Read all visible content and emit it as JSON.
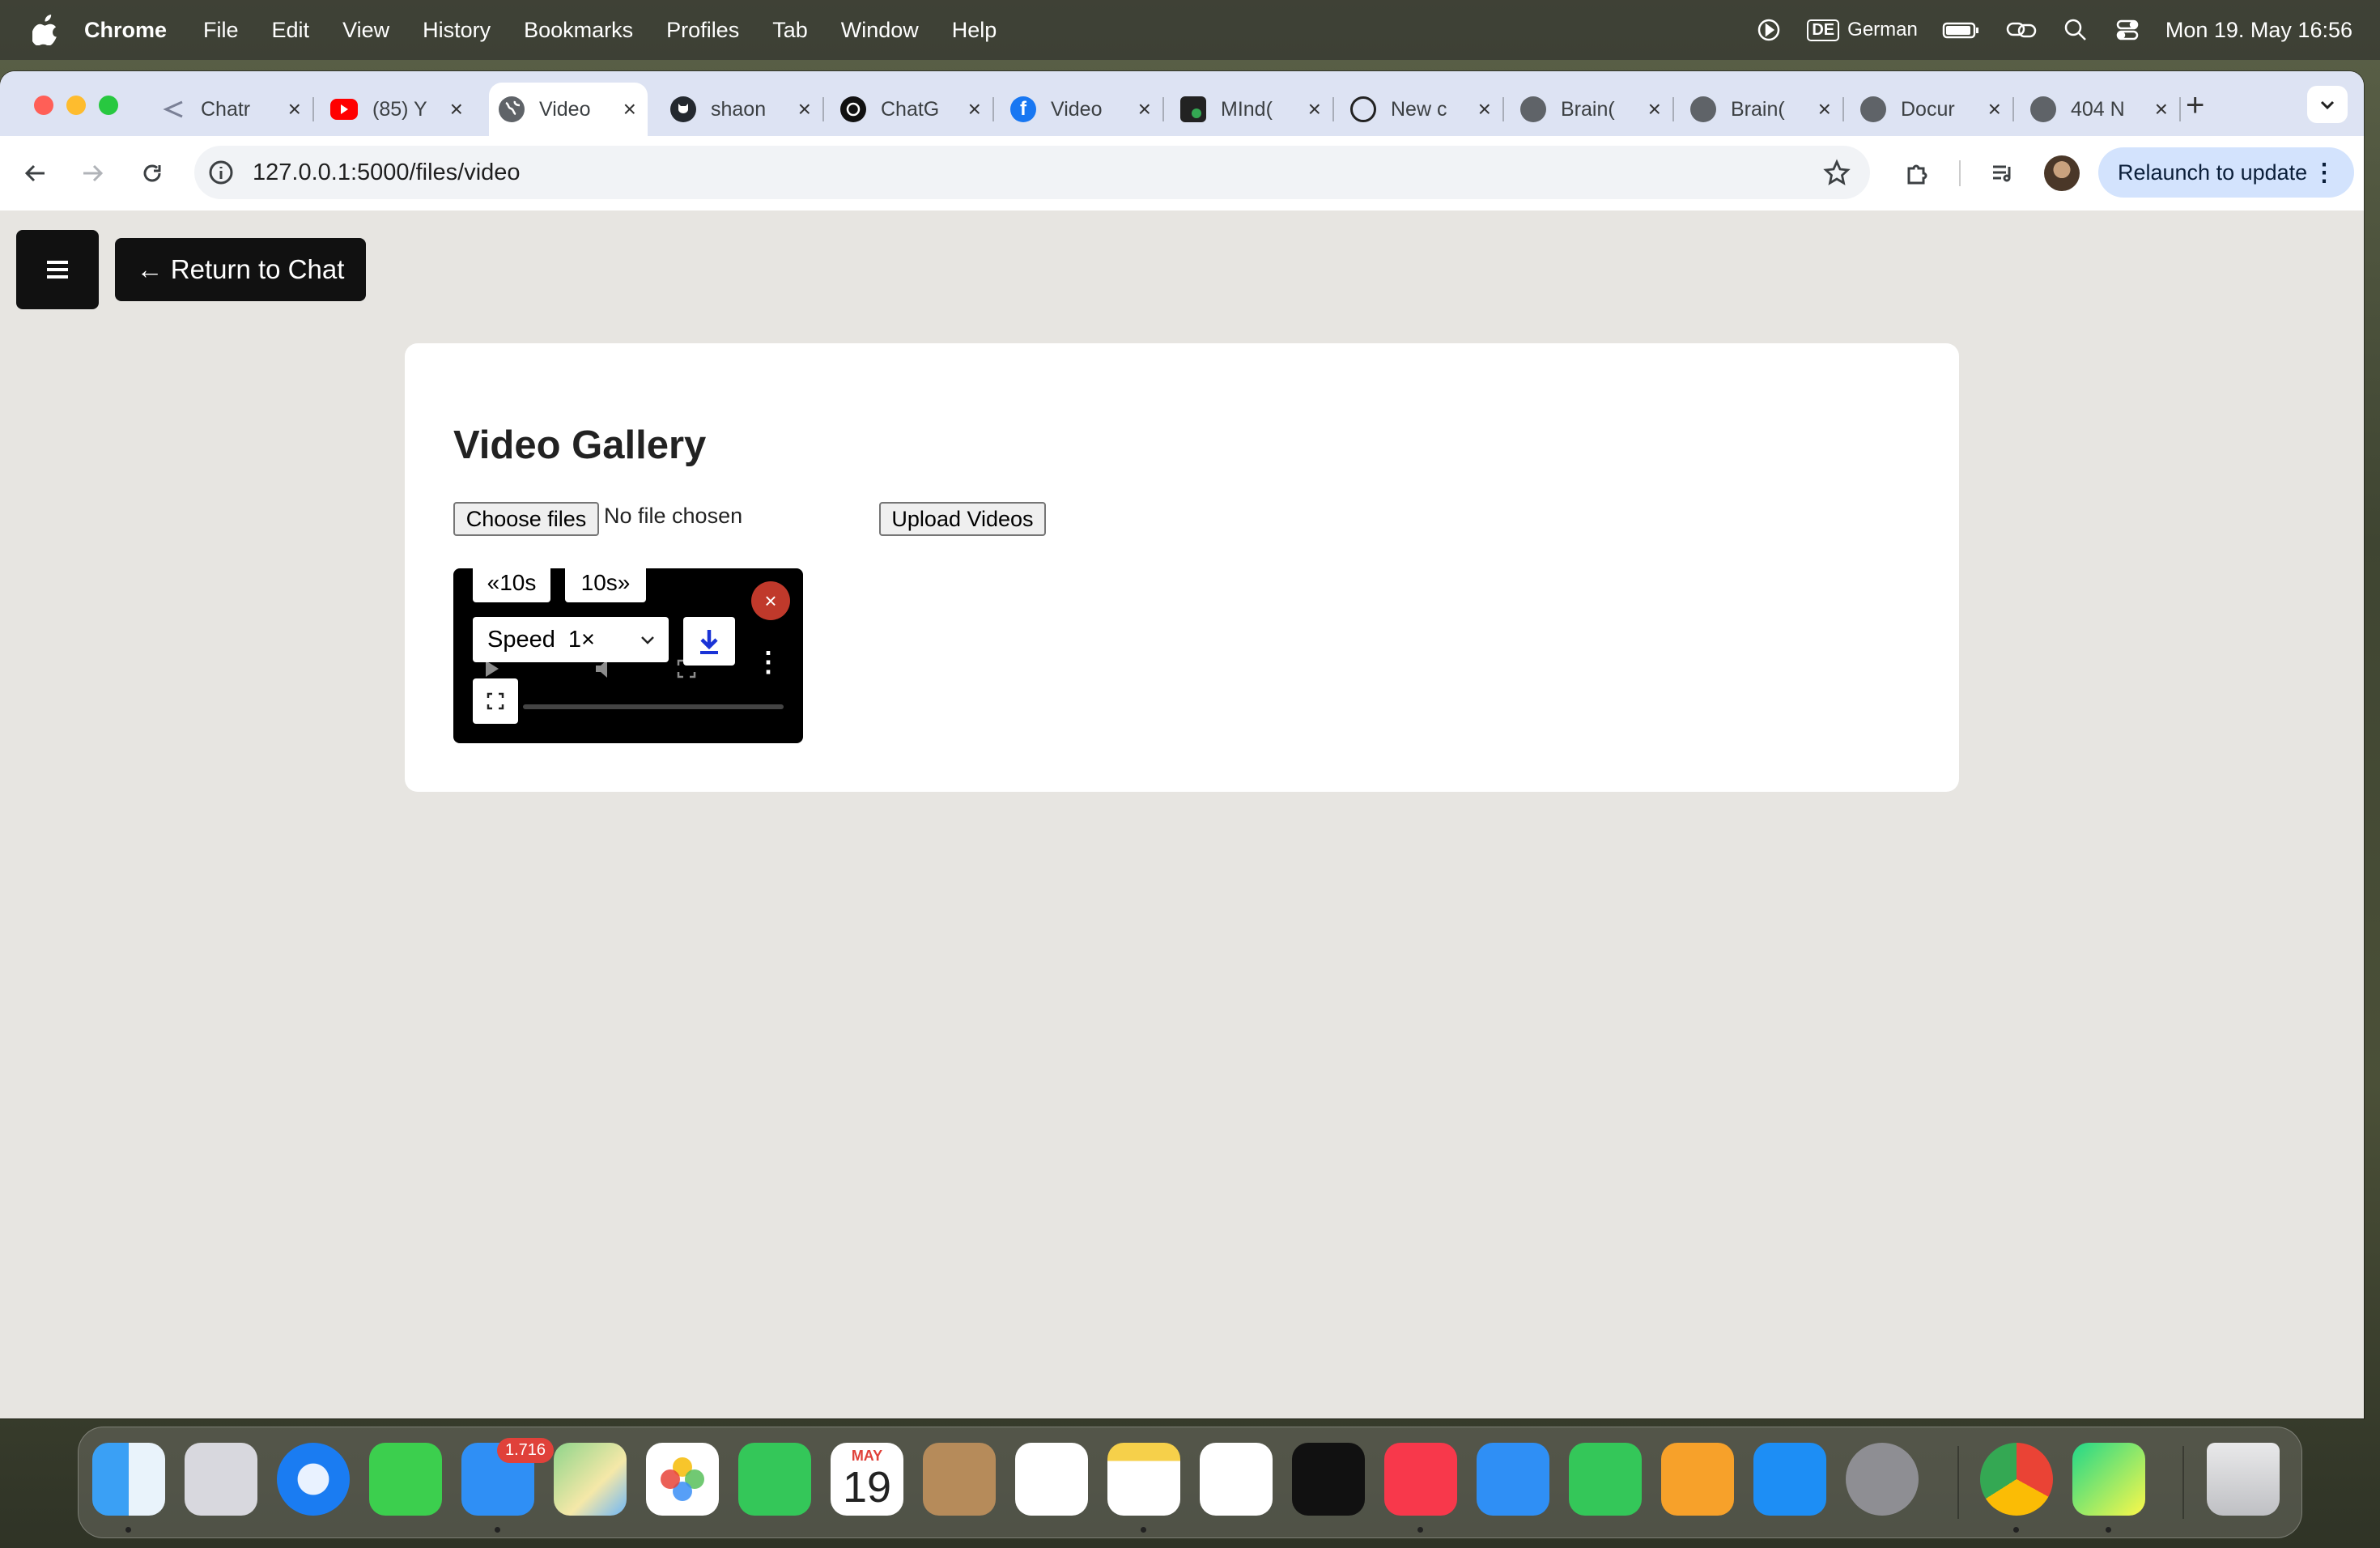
{
  "menubar": {
    "app_name": "Chrome",
    "items": [
      "File",
      "Edit",
      "View",
      "History",
      "Bookmarks",
      "Profiles",
      "Tab",
      "Window",
      "Help"
    ],
    "input_source_badge": "DE",
    "input_source_label": "German",
    "clock": "Mon 19. May  16:56"
  },
  "tabs": [
    {
      "title": "Chatr",
      "icon": "chatr-icon"
    },
    {
      "title": "(85) Y",
      "icon": "youtube-icon"
    },
    {
      "title": "Video",
      "icon": "globe-icon",
      "active": true
    },
    {
      "title": "shaon",
      "icon": "github-icon"
    },
    {
      "title": "ChatG",
      "icon": "openai-icon"
    },
    {
      "title": "Video",
      "icon": "facebook-icon"
    },
    {
      "title": "MInd(",
      "icon": "mind-icon"
    },
    {
      "title": "New c",
      "icon": "copilot-icon"
    },
    {
      "title": "Brain(",
      "icon": "globe-icon"
    },
    {
      "title": "Brain(",
      "icon": "globe-icon"
    },
    {
      "title": "Docur",
      "icon": "globe-icon"
    },
    {
      "title": "404 N",
      "icon": "globe-icon"
    }
  ],
  "toolbar": {
    "url": "127.0.0.1:5000/files/video",
    "relaunch_label": "Relaunch to update"
  },
  "page": {
    "return_label": "← Return to Chat",
    "title": "Video Gallery",
    "choose_files_label": "Choose files",
    "no_file_label": "No file chosen",
    "upload_label": "Upload Videos"
  },
  "player": {
    "rewind_label": "«10s",
    "forward_label": "10s»",
    "speed_label": "Speed",
    "speed_value": "1×",
    "close_symbol": "×",
    "progress": 0.0
  },
  "dock": {
    "mail_badge": "1.716",
    "calendar_month": "MAY",
    "calendar_day": "19",
    "apps": [
      "finder-icon",
      "launchpad-icon",
      "safari-icon",
      "messages-icon",
      "mail-icon",
      "maps-icon",
      "photos-icon",
      "facetime-icon",
      "calendar-icon",
      "contacts-icon",
      "reminders-icon",
      "notes-icon",
      "freeform-icon",
      "appletv-icon",
      "music-icon",
      "keynote-icon",
      "numbers-icon",
      "pages-icon",
      "appstore-icon",
      "settings-icon",
      "chrome-icon",
      "pycharm-icon",
      "trash-icon"
    ]
  },
  "colors": {
    "accent_relaunch": "#d3e3fd",
    "close_button": "#c0392b",
    "download_icon": "#1a33d6"
  }
}
